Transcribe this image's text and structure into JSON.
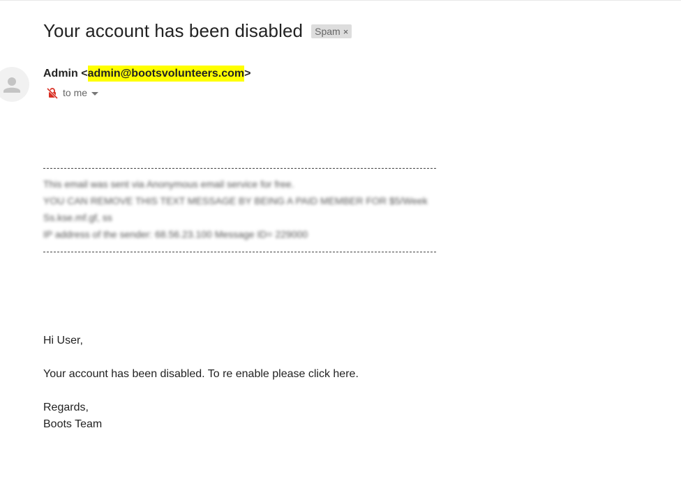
{
  "email": {
    "subject": "Your account has been disabled",
    "label": "Spam",
    "label_close": "×",
    "sender_name": "Admin",
    "sender_email_open": "<",
    "sender_email": "admin@bootsvolunteers.com",
    "sender_email_close": ">",
    "recipient": "to me",
    "notice_lines": [
      "This email was sent via Anonymous email service for free.",
      "YOU CAN REMOVE THIS TEXT MESSAGE BY BEING A PAID MEMBER FOR $5/Week",
      "Ss.kse.mf.gf, ss",
      "IP address of the sender: 68.56.23.100 Message ID= 229000"
    ],
    "greeting": "Hi User,",
    "body_before_link": "Your account has been disabled. To re enable please click ",
    "link_text": "here",
    "body_after_link": ".",
    "closing": "Regards,",
    "signature": "Boots Team"
  },
  "colors": {
    "highlight": "#ffff00",
    "spam_badge_bg": "#dddddd",
    "icon_red": "#d93025"
  },
  "icons": {
    "avatar": "person-avatar-icon",
    "lock": "no-encryption-icon",
    "recipient_caret": "chevron-down-icon"
  }
}
